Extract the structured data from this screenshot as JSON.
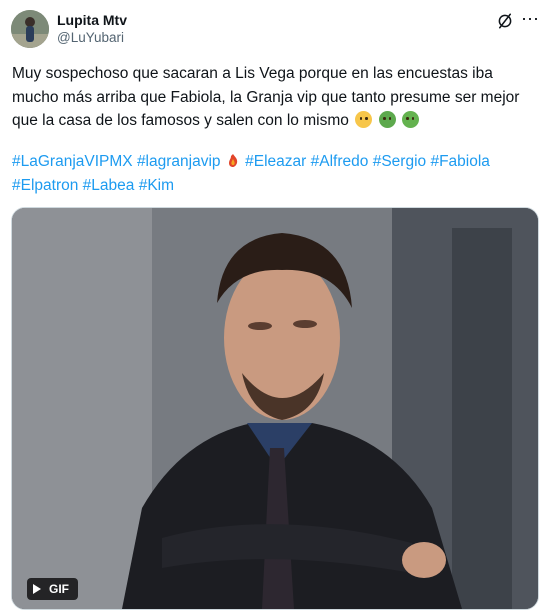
{
  "author": {
    "name": "Lupita Mtv",
    "handle": "@LuYubari"
  },
  "header_icons": [
    "x-logo-icon",
    "more-icon"
  ],
  "tweet": {
    "text": "Muy sospechoso que sacaran a Lis Vega porque en las encuestas iba mucho más arriba que Fabiola, la Granja vip que tanto presume ser mejor que la casa de los famosos y salen con lo mismo",
    "emojis": [
      "woozy-face",
      "nauseated-face",
      "vomiting-face"
    ],
    "hashtags": [
      "#LaGranjaVIPMX",
      "#lagranjavip",
      "#Eleazar",
      "#Alfredo",
      "#Sergio",
      "#Fabiola",
      "#Elpatron",
      "#Labea",
      "#Kim"
    ]
  },
  "media": {
    "type": "gif",
    "badge": "GIF"
  },
  "colors": {
    "link": "#1d9bf0",
    "secondary_text": "#536471",
    "primary_text": "#0f1419"
  }
}
